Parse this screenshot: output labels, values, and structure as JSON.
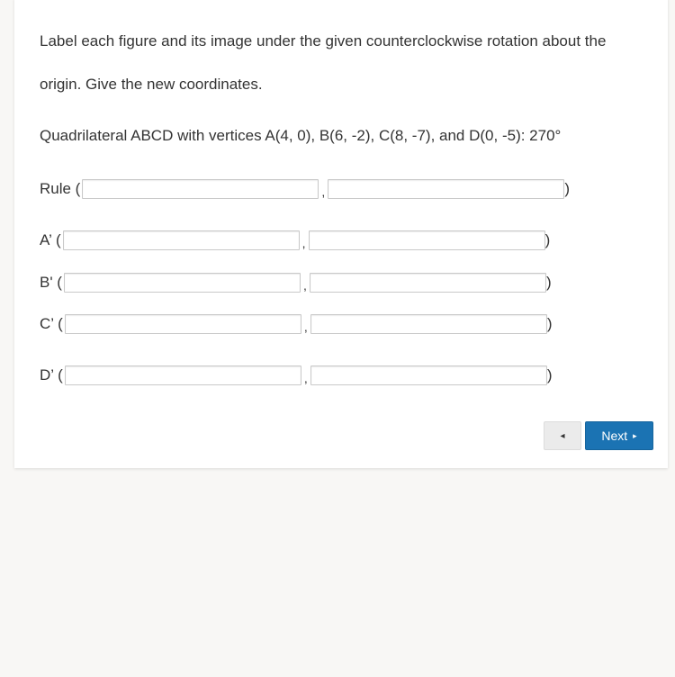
{
  "instructions": {
    "line1": "Label each figure and its image under the given counterclockwise rotation about the",
    "line2": "origin. Give the new coordinates."
  },
  "problem": "Quadrilateral ABCD with vertices A(4, 0), B(6, -2), C(8, -7), and D(0, -5): 270°",
  "rows": [
    {
      "label": "Rule (",
      "x_value": "",
      "y_value": "",
      "comma": ",",
      "close": ")"
    },
    {
      "label": "A’ (",
      "x_value": "",
      "y_value": "",
      "comma": ",",
      "close": ")"
    },
    {
      "label": "B' (",
      "x_value": "",
      "y_value": "",
      "comma": ",",
      "close": ")"
    },
    {
      "label": "C’ (",
      "x_value": "",
      "y_value": "",
      "comma": ",",
      "close": ")"
    },
    {
      "label": "D’ (",
      "x_value": "",
      "y_value": "",
      "comma": ",",
      "close": ")"
    }
  ],
  "nav": {
    "prev_icon": "◂",
    "next_label": "Next",
    "next_icon": "▸"
  },
  "colors": {
    "primary_button": "#1b73b3",
    "secondary_button": "#ebebeb",
    "background": "#f8f7f5"
  }
}
